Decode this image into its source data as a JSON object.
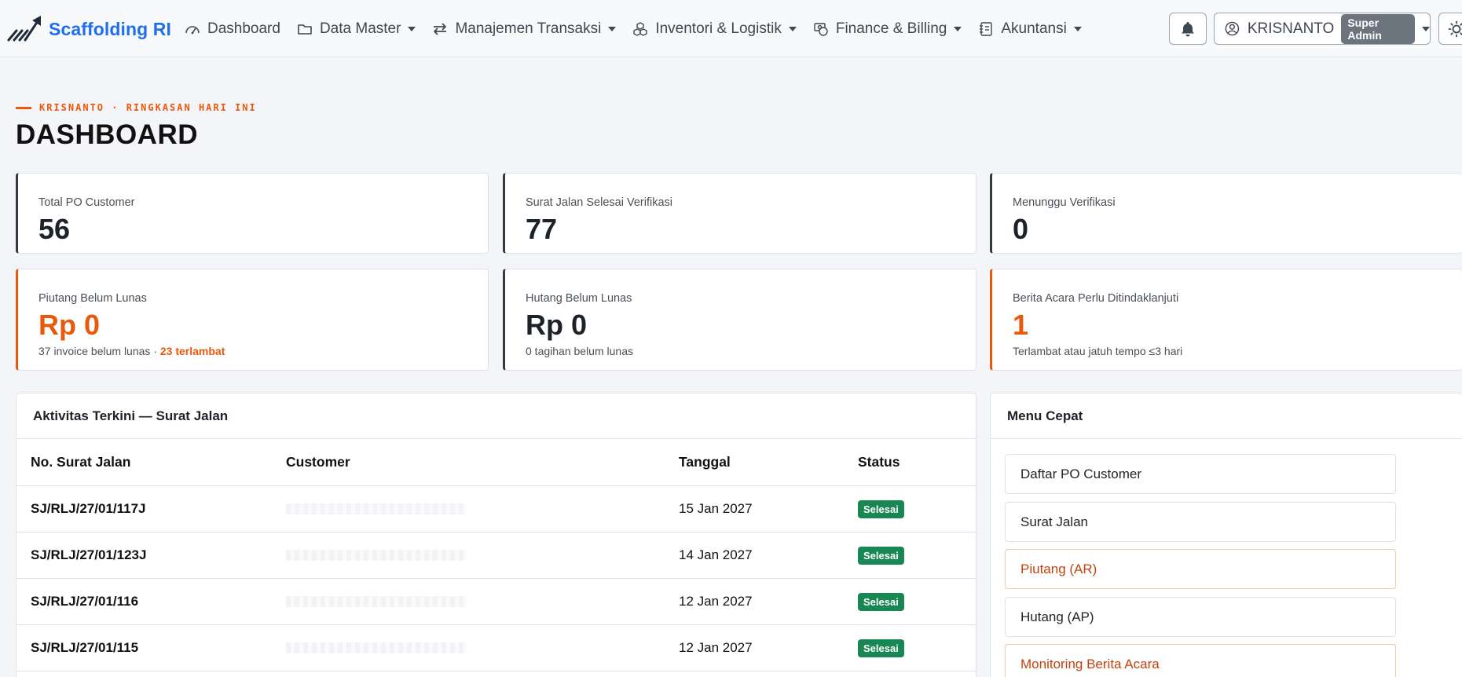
{
  "brand": {
    "name": "Scaffolding RI",
    "logo_icon": "scaffold-logo-icon",
    "color": "#1f6feb"
  },
  "nav": {
    "items": [
      {
        "label": "Dashboard",
        "icon": "speedometer-icon",
        "has_dropdown": false
      },
      {
        "label": "Data Master",
        "icon": "folder-icon",
        "has_dropdown": true
      },
      {
        "label": "Manajemen Transaksi",
        "icon": "swap-arrows-icon",
        "has_dropdown": true
      },
      {
        "label": "Inventori & Logistik",
        "icon": "boxes-icon",
        "has_dropdown": true
      },
      {
        "label": "Finance & Billing",
        "icon": "cash-coin-icon",
        "has_dropdown": true
      },
      {
        "label": "Akuntansi",
        "icon": "journal-icon",
        "has_dropdown": true
      }
    ]
  },
  "user": {
    "name": "KRISNANTO",
    "role": "Super Admin"
  },
  "header": {
    "eyebrow": "KRISNANTO · RINGKASAN HARI INI",
    "title": "DASHBOARD"
  },
  "stats": {
    "po_customer": {
      "label": "Total PO Customer",
      "value": "56"
    },
    "sj_verified": {
      "label": "Surat Jalan Selesai Verifikasi",
      "value": "77"
    },
    "waiting_verification": {
      "label": "Menunggu Verifikasi",
      "value": "0"
    },
    "receivables": {
      "label": "Piutang Belum Lunas",
      "value": "Rp 0",
      "sub_count": "37 invoice belum lunas",
      "sub_sep": "·",
      "sub_late": "23 terlambat"
    },
    "payables": {
      "label": "Hutang Belum Lunas",
      "value": "Rp 0",
      "sub": "0 tagihan belum lunas"
    },
    "minutes": {
      "label": "Berita Acara Perlu Ditindaklanjuti",
      "value": "1",
      "sub": "Terlambat atau jatuh tempo ≤3 hari"
    }
  },
  "activity": {
    "title": "Aktivitas Terkini — Surat Jalan",
    "columns": [
      "No. Surat Jalan",
      "Customer",
      "Tanggal",
      "Status"
    ],
    "rows": [
      {
        "no": "SJ/RLJ/27/01/117J",
        "date": "15 Jan 2027",
        "status": "Selesai"
      },
      {
        "no": "SJ/RLJ/27/01/123J",
        "date": "14 Jan 2027",
        "status": "Selesai"
      },
      {
        "no": "SJ/RLJ/27/01/116",
        "date": "12 Jan 2027",
        "status": "Selesai"
      },
      {
        "no": "SJ/RLJ/27/01/115",
        "date": "12 Jan 2027",
        "status": "Selesai"
      }
    ],
    "status_color": "#198754"
  },
  "quick_menu": {
    "title": "Menu Cepat",
    "items": [
      {
        "label": "Daftar PO Customer"
      },
      {
        "label": "Surat Jalan"
      },
      {
        "label": "Piutang (AR)"
      },
      {
        "label": "Hutang (AP)"
      },
      {
        "label": "Monitoring Berita Acara"
      }
    ]
  },
  "colors": {
    "accent": "#e8590c",
    "navy": "#343a40",
    "success": "#198754"
  }
}
